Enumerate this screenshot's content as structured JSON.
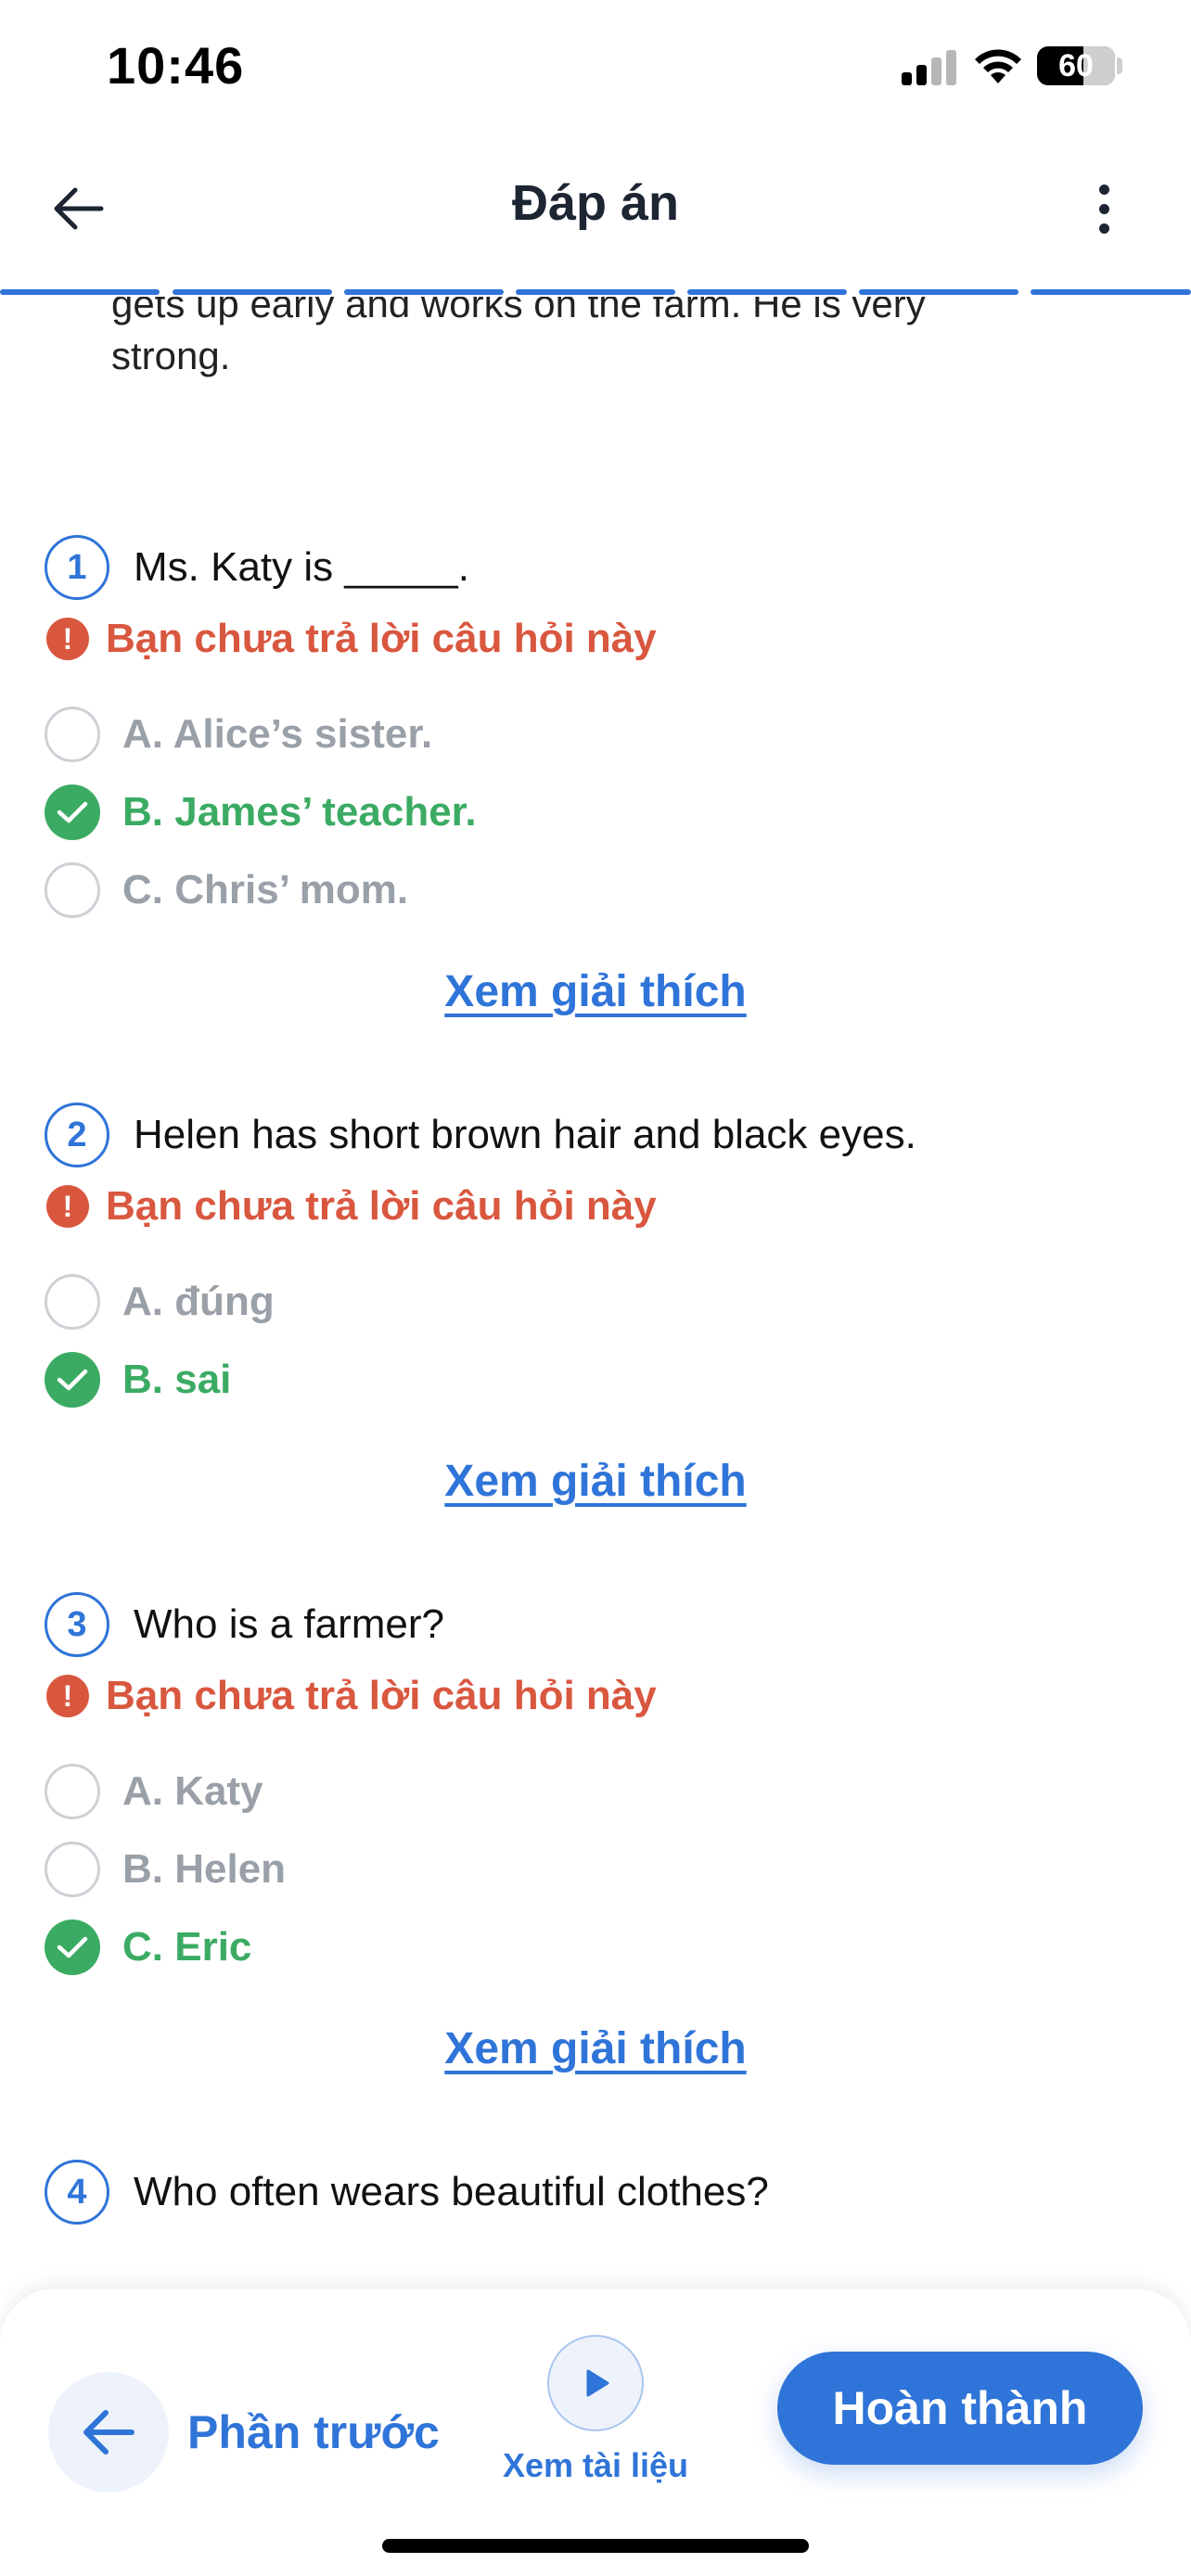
{
  "status_bar": {
    "time": "10:46",
    "battery": "60"
  },
  "header": {
    "title": "Đáp án"
  },
  "passage_tail": {
    "partial_line": "gets up early and works on the farm. He is very",
    "last_line": "strong."
  },
  "unanswered_text": "Bạn chưa trả lời câu hỏi này",
  "explain_label": "Xem giải thích",
  "questions": [
    {
      "number": "1",
      "text": "Ms. Katy is _____.",
      "options": [
        {
          "label": "A. Alice’s sister.",
          "correct": false
        },
        {
          "label": "B. James’ teacher.",
          "correct": true
        },
        {
          "label": "C. Chris’ mom.",
          "correct": false
        }
      ]
    },
    {
      "number": "2",
      "text": "Helen has short brown hair and black eyes.",
      "options": [
        {
          "label": "A. đúng",
          "correct": false
        },
        {
          "label": "B. sai",
          "correct": true
        }
      ]
    },
    {
      "number": "3",
      "text": "Who is a farmer?",
      "options": [
        {
          "label": "A. Katy",
          "correct": false
        },
        {
          "label": "B. Helen",
          "correct": false
        },
        {
          "label": "C. Eric",
          "correct": true
        }
      ]
    },
    {
      "number": "4",
      "text": "Who often wears beautiful clothes?",
      "options": []
    }
  ],
  "bottom_bar": {
    "prev_label": "Phần trước",
    "docs_label": "Xem tài liệu",
    "finish_label": "Hoàn thành"
  },
  "colors": {
    "accent": "#2f74d8",
    "correct": "#3bab63",
    "warning": "#d9573f",
    "muted": "#9aa0a8"
  }
}
